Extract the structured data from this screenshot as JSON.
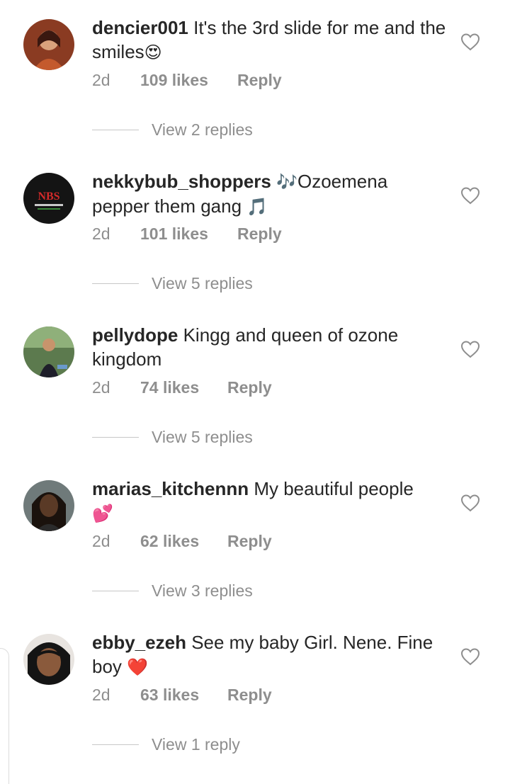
{
  "comments": [
    {
      "username": "dencier001",
      "text": "It's the 3rd slide for me and the smiles",
      "emoji": "😍",
      "time": "2d",
      "likes": "109 likes",
      "reply": "Reply",
      "view_replies": "View 2 replies",
      "avatar_color": "#6b2a1c"
    },
    {
      "username": "nekkybub_shoppers",
      "text_before": "🎶",
      "text": "Ozoemena pepper them gang",
      "emoji": "🎵",
      "time": "2d",
      "likes": "101 likes",
      "reply": "Reply",
      "view_replies": "View 5 replies",
      "avatar_color": "#141414",
      "avatar_text": "NBS"
    },
    {
      "username": "pellydope",
      "text": "Kingg and queen of ozone kingdom",
      "time": "2d",
      "likes": "74 likes",
      "reply": "Reply",
      "view_replies": "View 5 replies",
      "avatar_color": "#3c5a3a"
    },
    {
      "username": "marias_kitchennn",
      "text": "My beautiful people",
      "emoji": "💕",
      "time": "2d",
      "likes": "62 likes",
      "reply": "Reply",
      "view_replies": "View 3 replies",
      "avatar_color": "#2a1b14"
    },
    {
      "username": "ebby_ezeh",
      "text": "See my baby Girl. Nene. Fine boy",
      "emoji": "❤️",
      "time": "2d",
      "likes": "63 likes",
      "reply": "Reply",
      "view_replies": "View 1 reply",
      "avatar_color": "#1a1a1a"
    }
  ],
  "colors": {
    "text": "#262626",
    "secondary": "#8e8e8e",
    "heart_outline": "#8e8e8e",
    "emoji_heart": "#e0245e"
  },
  "icons": {
    "like": "heart-outline-icon"
  }
}
